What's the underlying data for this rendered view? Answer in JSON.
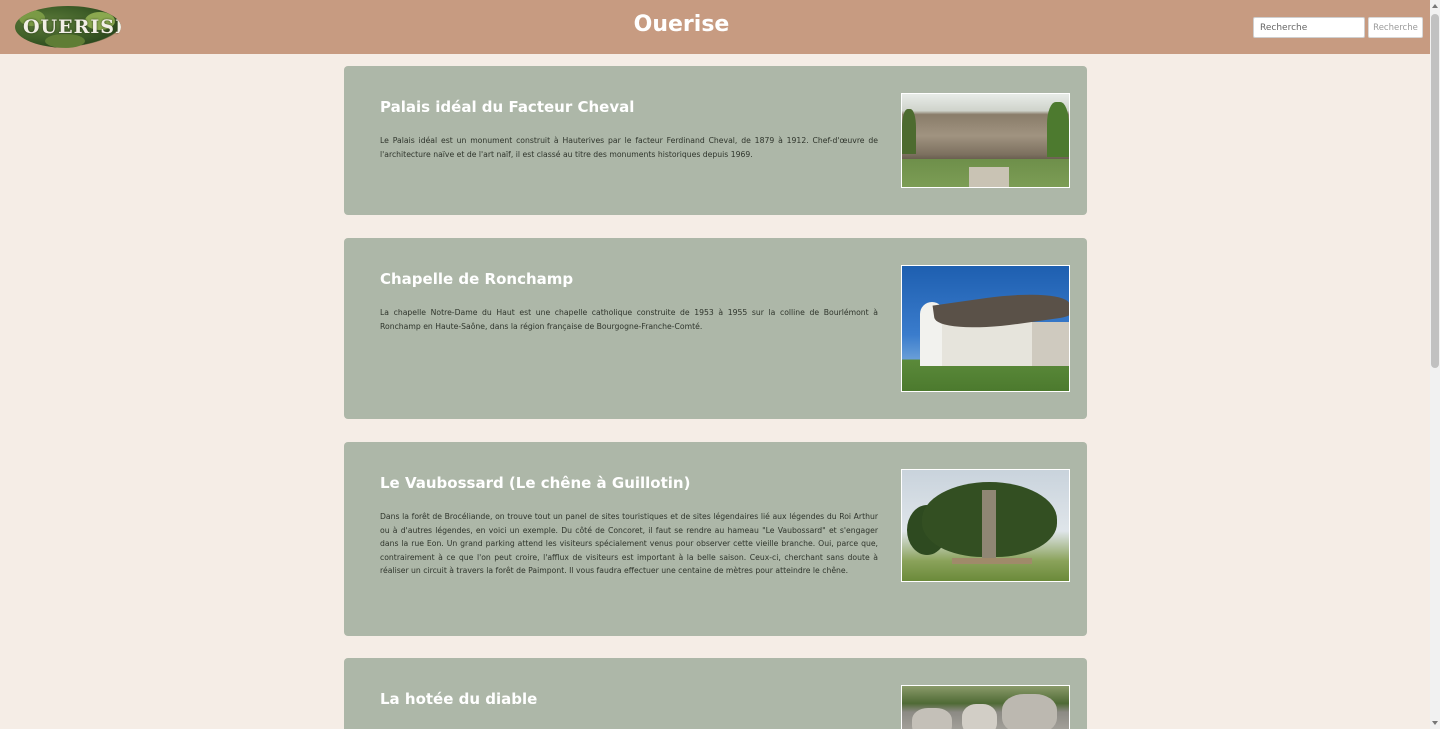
{
  "header": {
    "logo_text": "OUERISE",
    "site_title": "Ouerise",
    "search": {
      "placeholder": "Recherche",
      "button_label": "Recherche"
    }
  },
  "cards": [
    {
      "title": "Palais idéal du Facteur Cheval",
      "text": "Le Palais idéal est un monument construit à Hauterives par le facteur Ferdinand Cheval, de 1879 à 1912. Chef-d'œuvre de l'architecture naïve et de l'art naïf, il est classé au titre des monuments historiques depuis 1969.",
      "image": "palais-ideal-photo"
    },
    {
      "title": "Chapelle de Ronchamp",
      "text": "La chapelle Notre-Dame du Haut est une chapelle catholique construite de 1953 à 1955 sur la colline de Bourlémont à Ronchamp en Haute-Saône, dans la région française de Bourgogne-Franche-Comté.",
      "image": "ronchamp-chapel-photo"
    },
    {
      "title": "Le Vaubossard (Le chêne à Guillotin)",
      "text": "Dans la forêt de Brocéliande, on trouve tout un panel de sites touristiques et de sites légendaires lié aux légendes du Roi Arthur ou à d'autres légendes, en voici un exemple. Du côté de Concoret, il faut se rendre au hameau \"Le Vaubossard\" et s'engager dans la rue Eon. Un grand parking attend les visiteurs spécialement venus pour observer cette vieille branche. Oui, parce que, contrairement à ce que l'on peut croire, l'afflux de visiteurs est important à la belle saison. Ceux-ci, cherchant sans doute à réaliser un circuit à travers la forêt de Paimpont. Il vous faudra effectuer une centaine de mètres pour atteindre le chêne.",
      "image": "oak-tree-photo"
    },
    {
      "title": "La hotée du diable",
      "text": "",
      "image": "rocks-photo"
    }
  ]
}
